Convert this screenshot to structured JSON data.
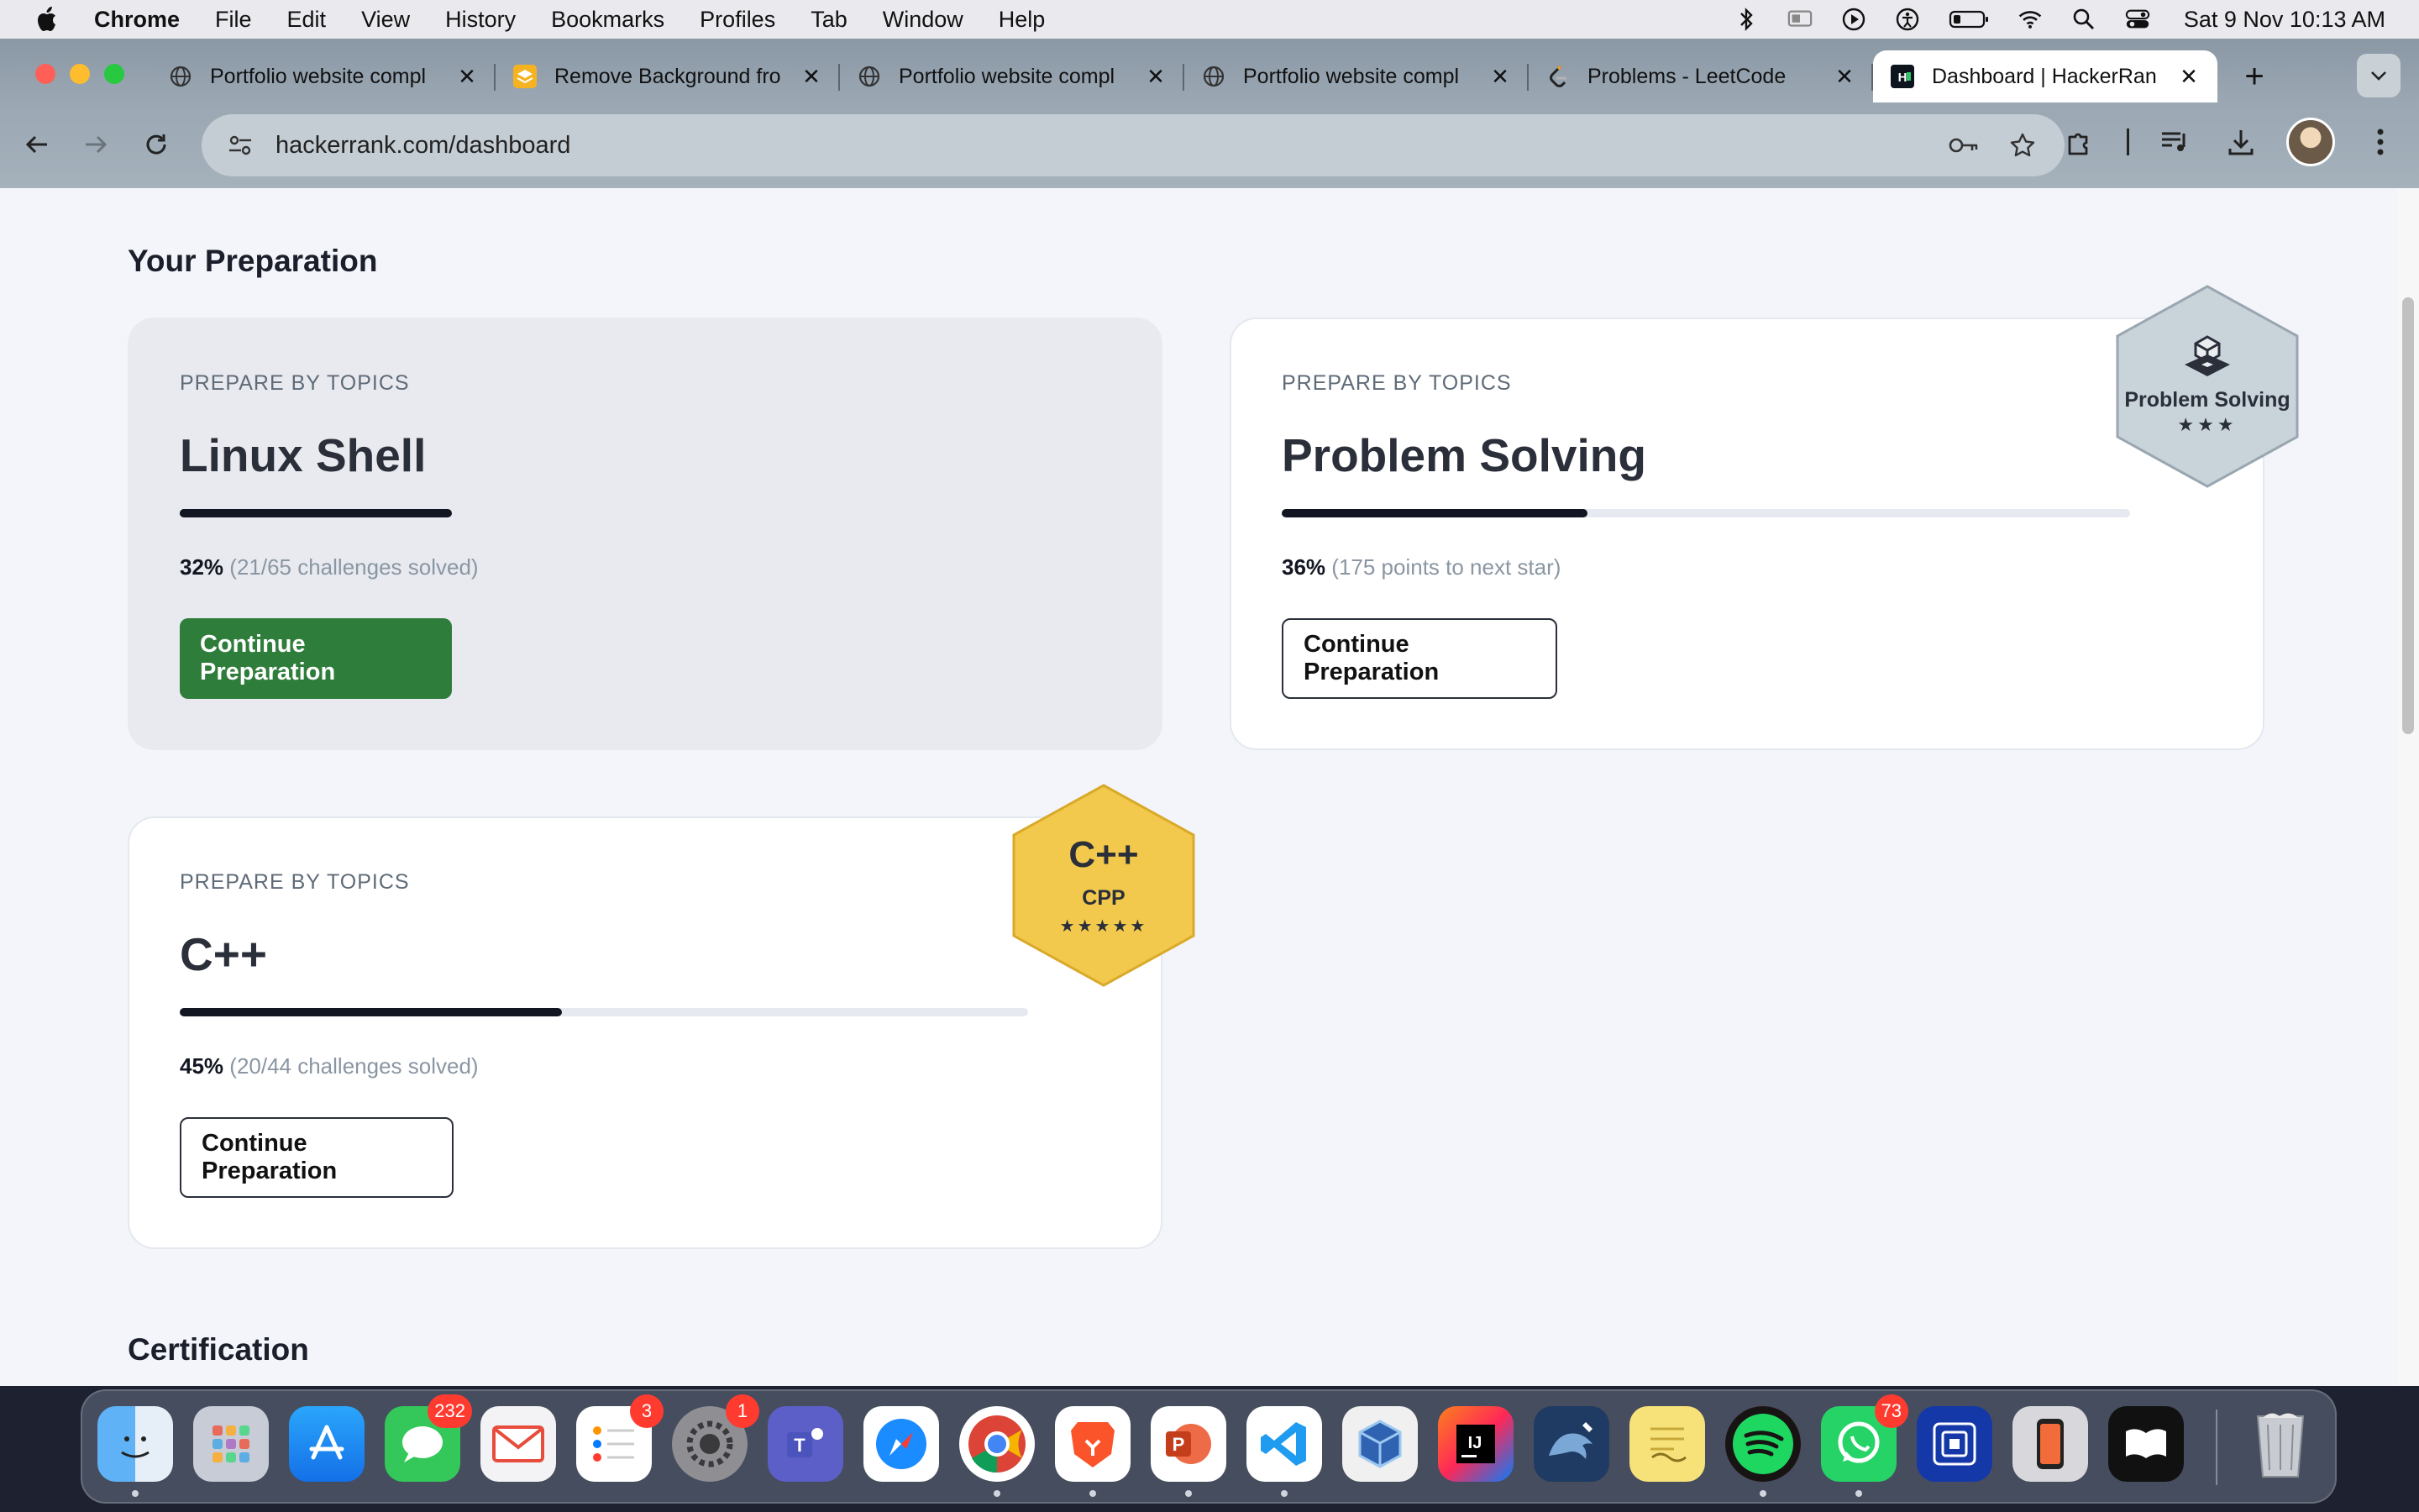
{
  "menubar": {
    "app": "Chrome",
    "items": [
      "File",
      "Edit",
      "View",
      "History",
      "Bookmarks",
      "Profiles",
      "Tab",
      "Window",
      "Help"
    ],
    "clock": "Sat 9 Nov  10:13 AM"
  },
  "tabs": [
    {
      "title": "Portfolio website compl",
      "icon": "globe-icon"
    },
    {
      "title": "Remove Background fro",
      "icon": "removebg-icon"
    },
    {
      "title": "Portfolio website compl",
      "icon": "globe-icon"
    },
    {
      "title": "Portfolio website compl",
      "icon": "globe-icon"
    },
    {
      "title": "Problems - LeetCode",
      "icon": "leetcode-icon"
    },
    {
      "title": "Dashboard | HackerRan",
      "icon": "hackerrank-icon"
    }
  ],
  "omnibox": {
    "url": "hackerrank.com/dashboard"
  },
  "page": {
    "section_title": "Your Preparation",
    "cards": [
      {
        "overline": "PREPARE BY TOPICS",
        "topic": "Linux Shell",
        "percent": "32%",
        "percent_value": 0.32,
        "detail": "(21/65 challenges solved)",
        "button": "Continue Preparation"
      },
      {
        "overline": "PREPARE BY TOPICS",
        "topic": "Problem Solving",
        "percent": "36%",
        "percent_value": 0.36,
        "detail": "(175 points to next star)",
        "button": "Continue Preparation",
        "badge": {
          "label": "Problem Solving",
          "stars": "★★★"
        }
      },
      {
        "overline": "PREPARE BY TOPICS",
        "topic": "C++",
        "percent": "45%",
        "percent_value": 0.45,
        "detail": "(20/44 challenges solved)",
        "button": "Continue Preparation",
        "badge": {
          "logo": "C++",
          "label": "CPP",
          "stars": "★★★★★"
        }
      }
    ],
    "next_section_title": "Certification"
  },
  "dock": {
    "messages_badge": "232",
    "reminders_badge": "3",
    "settings_badge": "1",
    "whatsapp_badge": "73"
  },
  "colors": {
    "green_button": "#2e7d3a",
    "progress_fill": "#121622",
    "cpp_badge": "#f2c94c",
    "ps_badge": "#c9d3da"
  }
}
